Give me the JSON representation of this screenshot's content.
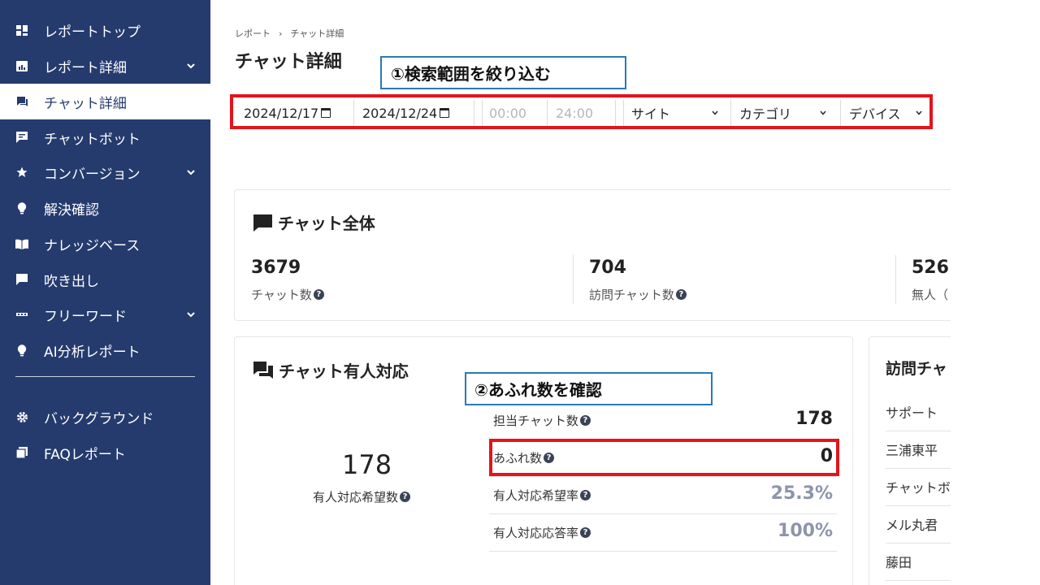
{
  "sidebar": {
    "items": [
      {
        "label": "レポートトップ",
        "icon": "dashboard-icon"
      },
      {
        "label": "レポート詳細",
        "icon": "report-icon",
        "expandable": true
      },
      {
        "label": "チャット詳細",
        "icon": "chat-icon",
        "active": true
      },
      {
        "label": "チャットボット",
        "icon": "chatbot-icon"
      },
      {
        "label": "コンバージョン",
        "icon": "star-icon",
        "expandable": true
      },
      {
        "label": "解決確認",
        "icon": "lightbulb-icon"
      },
      {
        "label": "ナレッジベース",
        "icon": "book-icon"
      },
      {
        "label": "吹き出し",
        "icon": "speech-bubble-icon"
      },
      {
        "label": "フリーワード",
        "icon": "keyboard-icon",
        "expandable": true
      },
      {
        "label": "AI分析レポート",
        "icon": "lightbulb-icon"
      },
      {
        "label": "バックグラウンド",
        "icon": "gear-icon"
      },
      {
        "label": "FAQレポート",
        "icon": "faq-icon"
      }
    ]
  },
  "breadcrumb": {
    "root": "レポート",
    "separator": "›",
    "current": "チャット詳細"
  },
  "page_title": "チャット詳細",
  "annotations": {
    "filter_callout": "①検索範囲を絞り込む",
    "overflow_callout": "②あふれ数を確認",
    "callout_border_color": "#2a7ab5",
    "highlight_color": "#e3141b"
  },
  "filters": {
    "start_date": "2024/12/17",
    "end_date": "2024/12/24",
    "start_time": "00:00",
    "end_time": "24:00",
    "site": "サイト",
    "category": "カテゴリ",
    "device": "デバイス"
  },
  "chat_overall": {
    "title": "チャット全体",
    "stats": [
      {
        "value": "3679",
        "label": "チャット数"
      },
      {
        "value": "704",
        "label": "訪問チャット数"
      },
      {
        "value": "526",
        "label": "無人（"
      }
    ]
  },
  "chat_manned": {
    "title": "チャット有人対応",
    "big_value": "178",
    "big_label": "有人対応希望数",
    "rows": [
      {
        "label": "担当チャット数",
        "value": "178"
      },
      {
        "label": "あふれ数",
        "value": "0"
      },
      {
        "label": "有人対応希望率",
        "value": "25.3%"
      },
      {
        "label": "有人対応応答率",
        "value": "100%"
      }
    ]
  },
  "visit_chat": {
    "title": "訪問チャ",
    "items": [
      "サポート",
      "三浦東平",
      "チャットボ",
      "メル丸君",
      "藤田"
    ]
  },
  "colors": {
    "sidebar_bg": "#253b6e",
    "percent_value": "#8d95ab"
  }
}
